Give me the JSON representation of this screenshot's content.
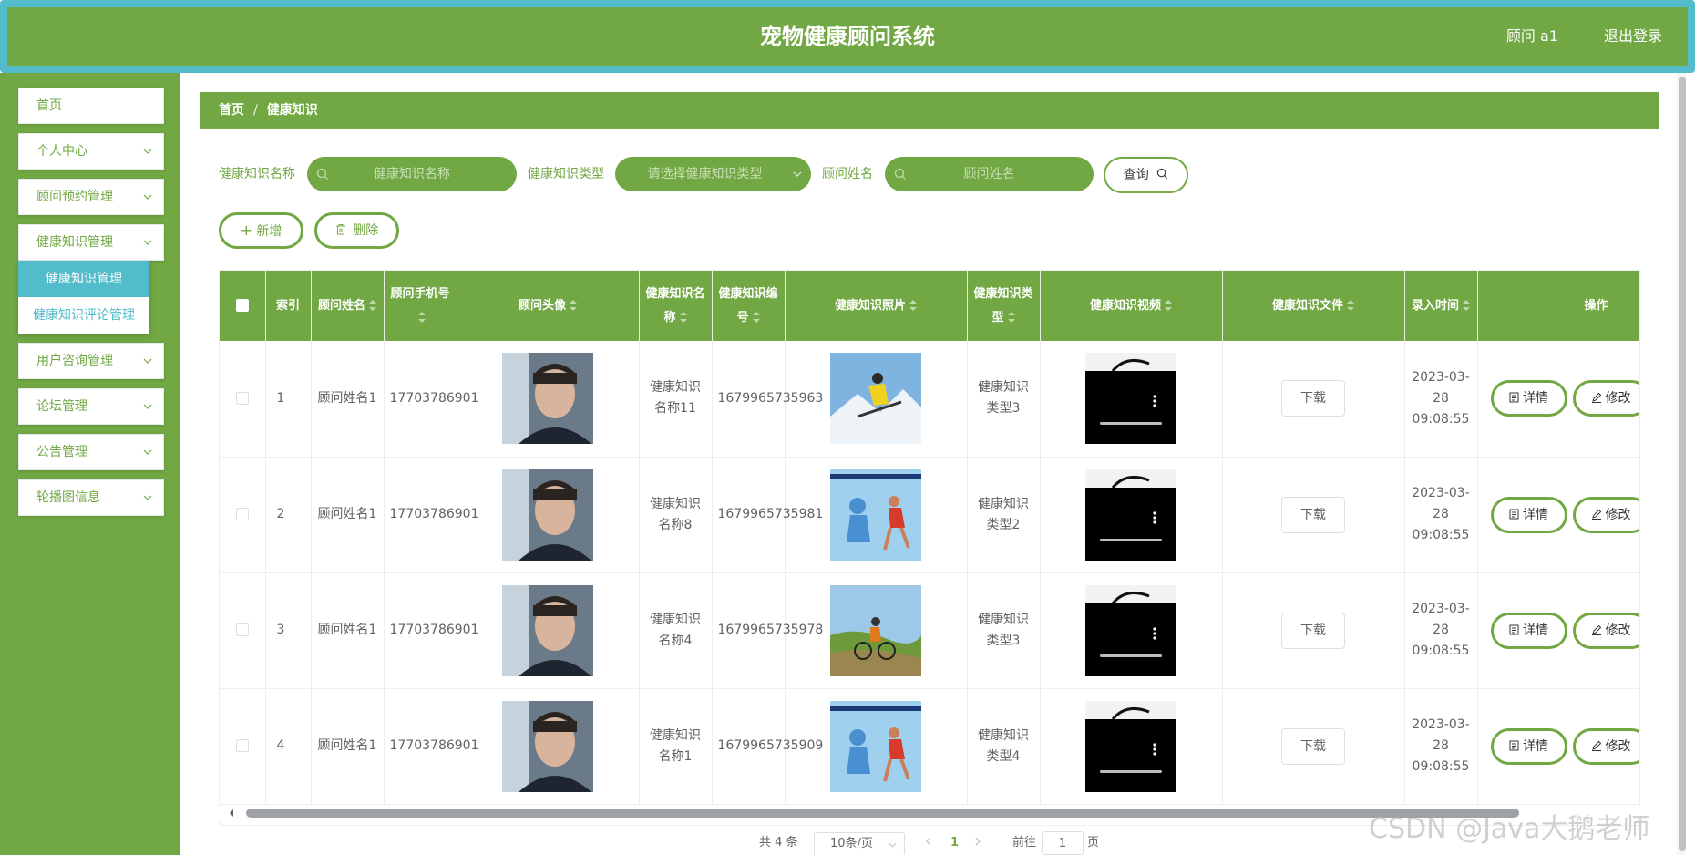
{
  "app": {
    "title": "宠物健康顾问系统",
    "user": "顾问 a1",
    "logout": "退出登录"
  },
  "sidebar": {
    "items": [
      {
        "label": "首页",
        "expandable": false
      },
      {
        "label": "个人中心",
        "expandable": true
      },
      {
        "label": "顾问预约管理",
        "expandable": true
      },
      {
        "label": "健康知识管理",
        "expandable": true
      },
      {
        "label": "用户咨询管理",
        "expandable": true
      },
      {
        "label": "论坛管理",
        "expandable": true
      },
      {
        "label": "公告管理",
        "expandable": true
      },
      {
        "label": "轮播图信息",
        "expandable": true
      }
    ],
    "submenu": {
      "active": "健康知识管理",
      "other": "健康知识评论管理"
    }
  },
  "breadcrumb": {
    "home": "首页",
    "sep": "/",
    "current": "健康知识"
  },
  "search": {
    "name_label": "健康知识名称",
    "name_placeholder": "健康知识名称",
    "type_label": "健康知识类型",
    "type_placeholder": "请选择健康知识类型",
    "advisor_label": "顾问姓名",
    "advisor_placeholder": "顾问姓名",
    "query_label": "查询"
  },
  "actions": {
    "add_label": "新增",
    "delete_label": "删除"
  },
  "table": {
    "headers": {
      "index": "索引",
      "advisor_name": "顾问姓名",
      "advisor_phone": "顾问手机号",
      "advisor_avatar": "顾问头像",
      "name": "健康知识名称",
      "code": "健康知识编号",
      "photo": "健康知识照片",
      "type": "健康知识类型",
      "video": "健康知识视频",
      "file": "健康知识文件",
      "time": "录入时间",
      "ops": "操作"
    },
    "download_label": "下载",
    "detail_label": "详情",
    "edit_label": "修改",
    "rows": [
      {
        "index": "1",
        "advisor_name": "顾问姓名1",
        "advisor_phone": "17703786901",
        "name": "健康知识名称11",
        "code": "1679965735963",
        "photo": "skier",
        "type": "健康知识类型3",
        "time": "2023-03-28 09:08:55"
      },
      {
        "index": "2",
        "advisor_name": "顾问姓名1",
        "advisor_phone": "17703786901",
        "name": "健康知识名称8",
        "code": "1679965735981",
        "photo": "runner",
        "type": "健康知识类型2",
        "time": "2023-03-28 09:08:55"
      },
      {
        "index": "3",
        "advisor_name": "顾问姓名1",
        "advisor_phone": "17703786901",
        "name": "健康知识名称4",
        "code": "1679965735978",
        "photo": "cyclist",
        "type": "健康知识类型3",
        "time": "2023-03-28 09:08:55"
      },
      {
        "index": "4",
        "advisor_name": "顾问姓名1",
        "advisor_phone": "17703786901",
        "name": "健康知识名称1",
        "code": "1679965735909",
        "photo": "runner",
        "type": "健康知识类型4",
        "time": "2023-03-28 09:08:55"
      }
    ]
  },
  "pagination": {
    "total_text": "共 4 条",
    "page_size": "10条/页",
    "current_page": "1",
    "goto_label": "前往",
    "goto_value": "1",
    "page_suffix": "页"
  },
  "watermark": "CSDN @Java大鹅老师",
  "colors": {
    "primary": "#71a843",
    "accent": "#53bccb"
  }
}
